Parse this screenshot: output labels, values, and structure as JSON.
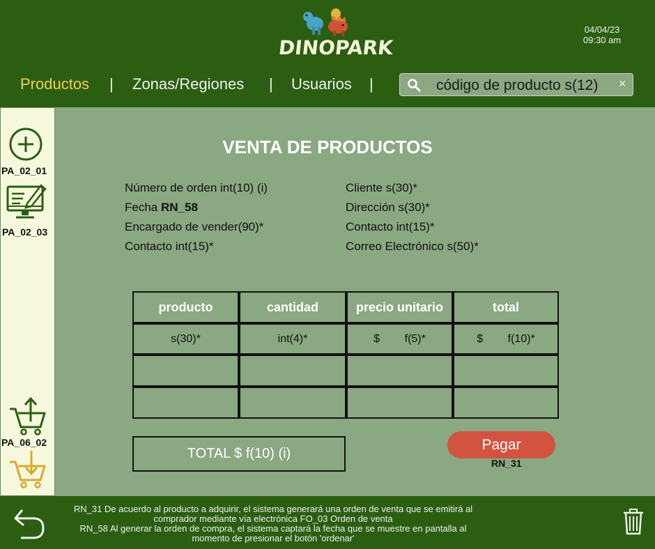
{
  "app": {
    "logo_text": "DINOPARK"
  },
  "header": {
    "date": "04/04/23",
    "time": "09:30 am"
  },
  "nav": {
    "items": [
      {
        "label": "Productos",
        "active": true
      },
      {
        "label": "Zonas/Regiones",
        "active": false
      },
      {
        "label": "Usuarios",
        "active": false
      }
    ],
    "separator": "|"
  },
  "search": {
    "value": "código de producto s(12)",
    "clear_symbol": "×",
    "icon": "search-icon"
  },
  "sidebar": {
    "items": [
      {
        "icon": "add-circle-icon",
        "label": "PA_02_01"
      },
      {
        "icon": "edit-monitor-icon",
        "label": "PA_02_03"
      },
      {
        "icon": "cart-upload-icon",
        "label": "PA_06_02"
      },
      {
        "icon": "cart-download-icon",
        "label": ""
      }
    ]
  },
  "main": {
    "title": "VENTA DE PRODUCTOS",
    "left_info": [
      {
        "text": "Número de orden int(10) (i)"
      },
      {
        "text": "Fecha ",
        "bold": "RN_58"
      },
      {
        "text": "Encargado de vender(90)*"
      },
      {
        "text": "Contacto int(15)*"
      }
    ],
    "right_info": [
      {
        "text": "Cliente s(30)*"
      },
      {
        "text": "Dirección s(30)*"
      },
      {
        "text": "Contacto int(15)*"
      },
      {
        "text": "Correo Electrónico s(50)*"
      }
    ],
    "table": {
      "headers": [
        "producto",
        "cantidad",
        "precio unitario",
        "total"
      ],
      "rows": [
        [
          "s(30)*",
          "int(4)*",
          "$        f(5)*",
          "$        f(10)*"
        ],
        [
          "",
          "",
          "",
          ""
        ],
        [
          "",
          "",
          "",
          ""
        ]
      ]
    },
    "total_label": "TOTAL $ f(10) (i)",
    "pay_button": "Pagar",
    "pay_rule": "RN_31"
  },
  "footer": {
    "lines": [
      "RN_31 De acuerdo al producto a adquirir, el sistema generará una orden de venta que se emitirá al",
      "comprador mediante vía electrónica FO_03 Orden de venta",
      "RN_58 Al generar la orden de compra, el sistema captará la fecha que se muestre en pantalla al",
      "momento de presionar el botón 'ordenar'"
    ],
    "back_icon": "back-arrow-icon",
    "trash_icon": "trash-icon"
  },
  "colors": {
    "header_bg": "#2c5e12",
    "main_bg": "#8aa881",
    "sidebar_bg": "#f5f8dc",
    "active_nav": "#f0d24a",
    "pay_button": "#d2533f"
  }
}
